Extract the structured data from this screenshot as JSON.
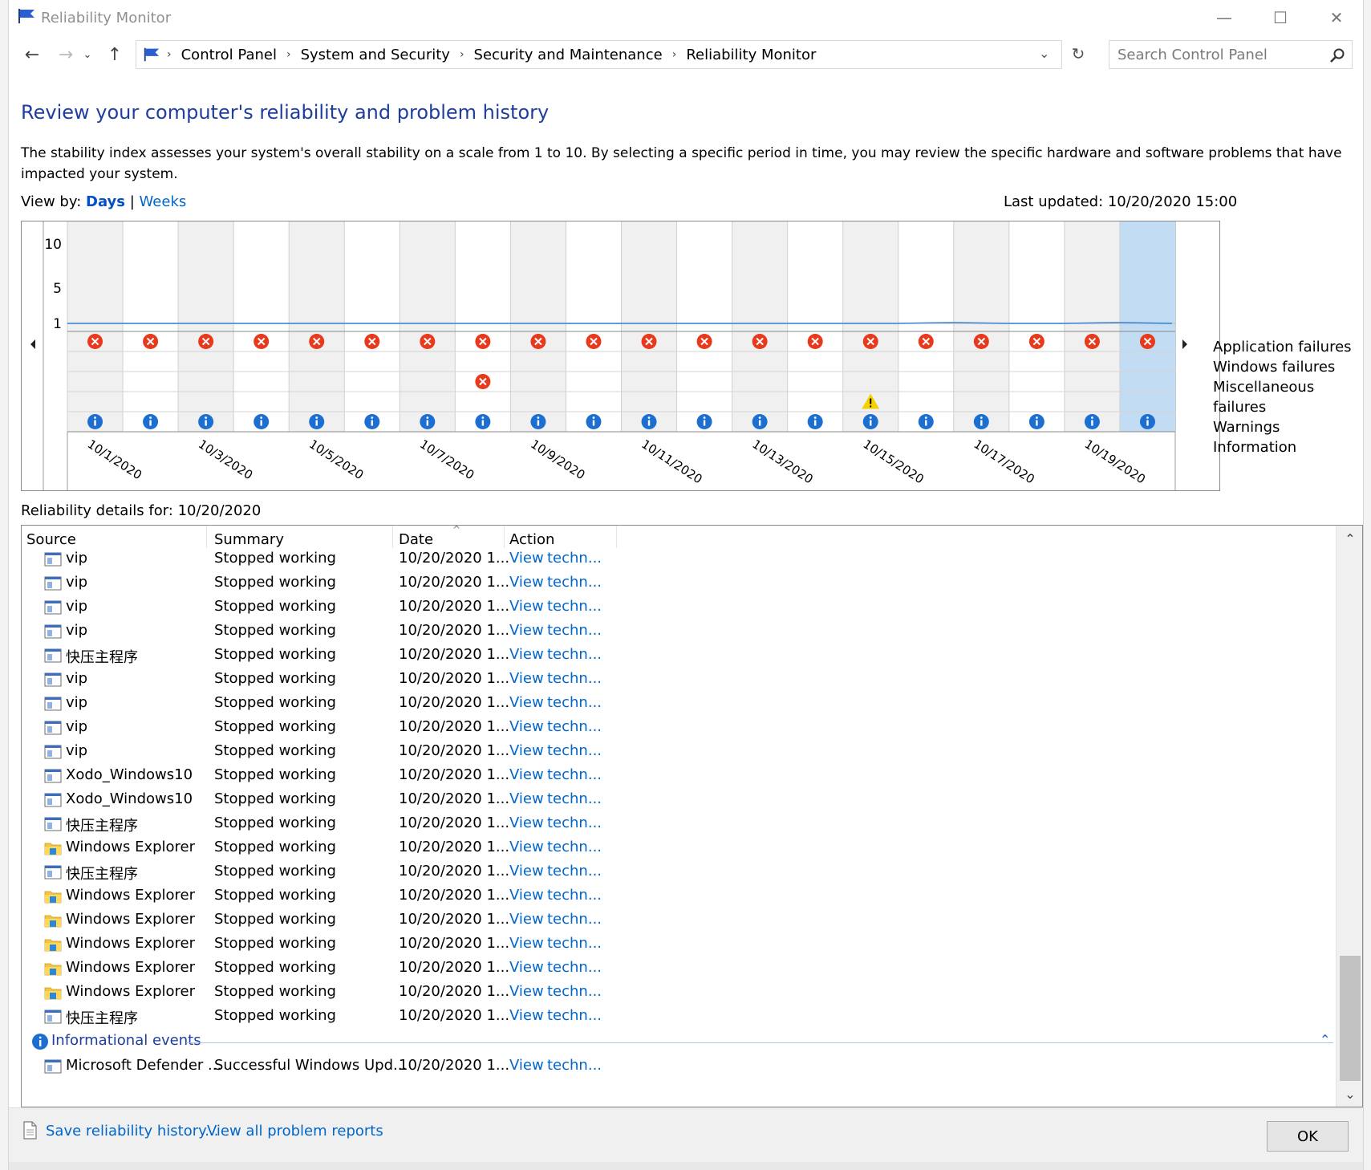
{
  "window": {
    "title": "Reliability Monitor",
    "controls": {
      "minimize": "—",
      "maximize": "☐",
      "close": "✕"
    }
  },
  "address": {
    "breadcrumbs": [
      "Control Panel",
      "System and Security",
      "Security and Maintenance",
      "Reliability Monitor"
    ],
    "search_placeholder": "Search Control Panel"
  },
  "page": {
    "heading": "Review your computer's reliability and problem history",
    "description": "The stability index assesses your system's overall stability on a scale from 1 to 10. By selecting a specific period in time, you may review the specific hardware and software problems that have impacted your system.",
    "view_by_label": "View by:",
    "view_days": "Days",
    "view_separator": "|",
    "view_weeks": "Weeks",
    "last_updated": "Last updated: 10/20/2020 15:00"
  },
  "chart_data": {
    "type": "line",
    "dates": [
      "10/1/2020",
      "10/2/2020",
      "10/3/2020",
      "10/4/2020",
      "10/5/2020",
      "10/6/2020",
      "10/7/2020",
      "10/8/2020",
      "10/9/2020",
      "10/10/2020",
      "10/11/2020",
      "10/12/2020",
      "10/13/2020",
      "10/14/2020",
      "10/15/2020",
      "10/16/2020",
      "10/17/2020",
      "10/18/2020",
      "10/19/2020",
      "10/20/2020"
    ],
    "tick_labels": [
      "10/1/2020",
      "10/3/2020",
      "10/5/2020",
      "10/7/2020",
      "10/9/2020",
      "10/11/2020",
      "10/13/2020",
      "10/15/2020",
      "10/17/2020",
      "10/19/2020"
    ],
    "stability_index": [
      1,
      1,
      1,
      1,
      1,
      1,
      1,
      1,
      1,
      1,
      1,
      1,
      1,
      1,
      1,
      1.1,
      1,
      1,
      1.1,
      1
    ],
    "y_ticks": [
      "10",
      "5",
      "1"
    ],
    "ylim": [
      1,
      10
    ],
    "selected_date": "10/20/2020",
    "legend": [
      "Application failures",
      "Windows failures",
      "Miscellaneous failures",
      "Warnings",
      "Information"
    ],
    "events": {
      "application_failures": [
        1,
        1,
        1,
        1,
        1,
        1,
        1,
        1,
        1,
        1,
        1,
        1,
        1,
        1,
        1,
        1,
        1,
        1,
        1,
        1
      ],
      "windows_failures": [
        0,
        0,
        0,
        0,
        0,
        0,
        0,
        0,
        0,
        0,
        0,
        0,
        0,
        0,
        0,
        0,
        0,
        0,
        0,
        0
      ],
      "miscellaneous_failures": [
        0,
        0,
        0,
        0,
        0,
        0,
        0,
        1,
        0,
        0,
        0,
        0,
        0,
        0,
        0,
        0,
        0,
        0,
        0,
        0
      ],
      "warnings": [
        0,
        0,
        0,
        0,
        0,
        0,
        0,
        0,
        0,
        0,
        0,
        0,
        0,
        0,
        1,
        0,
        0,
        0,
        0,
        0
      ],
      "information": [
        1,
        1,
        1,
        1,
        1,
        1,
        1,
        1,
        1,
        1,
        1,
        1,
        1,
        1,
        1,
        1,
        1,
        1,
        1,
        1
      ]
    },
    "colors": {
      "line": "#2f7fd1",
      "selected": "#c2dcf3",
      "shaded": "#f0f0f0",
      "failure": "#e8391c",
      "info": "#1c6fd1",
      "warning": "#f5d000"
    }
  },
  "details": {
    "label": "Reliability details for: 10/20/2020",
    "columns": [
      "Source",
      "Summary",
      "Date",
      "Action"
    ],
    "rows": [
      {
        "source": "vip",
        "summary": "Stopped working",
        "date": "10/20/2020 1...",
        "action_view": "View",
        "action_tech": "techn...",
        "icon": "app-window-icon"
      },
      {
        "source": "vip",
        "summary": "Stopped working",
        "date": "10/20/2020 1...",
        "action_view": "View",
        "action_tech": "techn...",
        "icon": "app-window-icon"
      },
      {
        "source": "vip",
        "summary": "Stopped working",
        "date": "10/20/2020 1...",
        "action_view": "View",
        "action_tech": "techn...",
        "icon": "app-window-icon"
      },
      {
        "source": "vip",
        "summary": "Stopped working",
        "date": "10/20/2020 1...",
        "action_view": "View",
        "action_tech": "techn...",
        "icon": "app-window-icon"
      },
      {
        "source": "快压主程序",
        "summary": "Stopped working",
        "date": "10/20/2020 1...",
        "action_view": "View",
        "action_tech": "techn...",
        "icon": "app-window-icon"
      },
      {
        "source": "vip",
        "summary": "Stopped working",
        "date": "10/20/2020 1...",
        "action_view": "View",
        "action_tech": "techn...",
        "icon": "app-window-icon"
      },
      {
        "source": "vip",
        "summary": "Stopped working",
        "date": "10/20/2020 1...",
        "action_view": "View",
        "action_tech": "techn...",
        "icon": "app-window-icon"
      },
      {
        "source": "vip",
        "summary": "Stopped working",
        "date": "10/20/2020 1...",
        "action_view": "View",
        "action_tech": "techn...",
        "icon": "app-window-icon"
      },
      {
        "source": "vip",
        "summary": "Stopped working",
        "date": "10/20/2020 1...",
        "action_view": "View",
        "action_tech": "techn...",
        "icon": "app-window-icon"
      },
      {
        "source": "Xodo_Windows10",
        "summary": "Stopped working",
        "date": "10/20/2020 1...",
        "action_view": "View",
        "action_tech": "techn...",
        "icon": "app-window-icon"
      },
      {
        "source": "Xodo_Windows10",
        "summary": "Stopped working",
        "date": "10/20/2020 1...",
        "action_view": "View",
        "action_tech": "techn...",
        "icon": "app-window-icon"
      },
      {
        "source": "快压主程序",
        "summary": "Stopped working",
        "date": "10/20/2020 1...",
        "action_view": "View",
        "action_tech": "techn...",
        "icon": "app-window-icon"
      },
      {
        "source": "Windows Explorer",
        "summary": "Stopped working",
        "date": "10/20/2020 1...",
        "action_view": "View",
        "action_tech": "techn...",
        "icon": "folder-icon"
      },
      {
        "source": "快压主程序",
        "summary": "Stopped working",
        "date": "10/20/2020 1...",
        "action_view": "View",
        "action_tech": "techn...",
        "icon": "app-window-icon"
      },
      {
        "source": "Windows Explorer",
        "summary": "Stopped working",
        "date": "10/20/2020 1...",
        "action_view": "View",
        "action_tech": "techn...",
        "icon": "folder-icon"
      },
      {
        "source": "Windows Explorer",
        "summary": "Stopped working",
        "date": "10/20/2020 1...",
        "action_view": "View",
        "action_tech": "techn...",
        "icon": "folder-icon"
      },
      {
        "source": "Windows Explorer",
        "summary": "Stopped working",
        "date": "10/20/2020 1...",
        "action_view": "View",
        "action_tech": "techn...",
        "icon": "folder-icon"
      },
      {
        "source": "Windows Explorer",
        "summary": "Stopped working",
        "date": "10/20/2020 1...",
        "action_view": "View",
        "action_tech": "techn...",
        "icon": "folder-icon"
      },
      {
        "source": "Windows Explorer",
        "summary": "Stopped working",
        "date": "10/20/2020 1...",
        "action_view": "View",
        "action_tech": "techn...",
        "icon": "folder-icon"
      },
      {
        "source": "快压主程序",
        "summary": "Stopped working",
        "date": "10/20/2020 1...",
        "action_view": "View",
        "action_tech": "techn...",
        "icon": "app-window-icon"
      }
    ],
    "info_group": {
      "title": "Informational events",
      "rows": [
        {
          "source": "Microsoft Defender ...",
          "summary": "Successful Windows Upd...",
          "date": "10/20/2020 1...",
          "action_view": "View",
          "action_tech": "techn...",
          "icon": "app-window-icon"
        }
      ]
    }
  },
  "footer": {
    "save_link": "Save reliability history...",
    "problems_link": "View all problem reports",
    "ok": "OK"
  }
}
